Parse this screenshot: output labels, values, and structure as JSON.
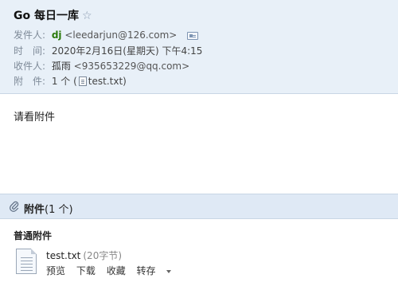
{
  "email": {
    "subject": "Go 每日一库",
    "star_icon": "star-outline-icon",
    "from_label": "发件人:",
    "from_name": "dj",
    "from_address": "<leedarjun@126.com>",
    "time_label": "时　间:",
    "time_value": "2020年2月16日(星期天) 下午4:15",
    "to_label": "收件人:",
    "to_name": "孤雨",
    "to_address": "<935653229@qq.com>",
    "attach_label": "附　件:",
    "attach_count": "1 个 (",
    "attach_file": "test.txt",
    "attach_close": ")",
    "body": "请看附件"
  },
  "attachments": {
    "bar_title": "附件",
    "bar_count": "(1 个)",
    "section_label": "普通附件",
    "files": [
      {
        "name": "test.txt",
        "size": "(20字节)",
        "actions": [
          "预览",
          "下载",
          "收藏",
          "转存"
        ]
      }
    ]
  }
}
